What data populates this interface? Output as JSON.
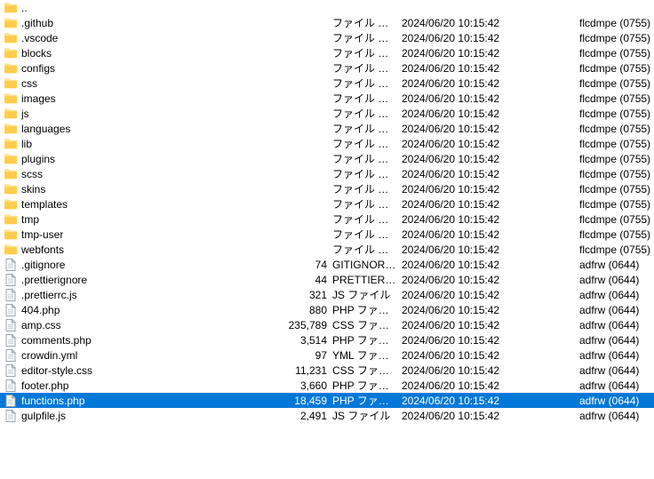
{
  "rows": [
    {
      "name": "..",
      "size": "",
      "type": "",
      "date": "",
      "perm": "",
      "icon": "folder",
      "selected": false
    },
    {
      "name": ".github",
      "size": "",
      "type": "ファイル フォ…",
      "date": "2024/06/20 10:15:42",
      "perm": "flcdmpe (0755)",
      "icon": "folder",
      "selected": false
    },
    {
      "name": ".vscode",
      "size": "",
      "type": "ファイル フォ…",
      "date": "2024/06/20 10:15:42",
      "perm": "flcdmpe (0755)",
      "icon": "folder",
      "selected": false
    },
    {
      "name": "blocks",
      "size": "",
      "type": "ファイル フォ…",
      "date": "2024/06/20 10:15:42",
      "perm": "flcdmpe (0755)",
      "icon": "folder",
      "selected": false
    },
    {
      "name": "configs",
      "size": "",
      "type": "ファイル フォ…",
      "date": "2024/06/20 10:15:42",
      "perm": "flcdmpe (0755)",
      "icon": "folder",
      "selected": false
    },
    {
      "name": "css",
      "size": "",
      "type": "ファイル フォ…",
      "date": "2024/06/20 10:15:42",
      "perm": "flcdmpe (0755)",
      "icon": "folder",
      "selected": false
    },
    {
      "name": "images",
      "size": "",
      "type": "ファイル フォ…",
      "date": "2024/06/20 10:15:42",
      "perm": "flcdmpe (0755)",
      "icon": "folder",
      "selected": false
    },
    {
      "name": "js",
      "size": "",
      "type": "ファイル フォ…",
      "date": "2024/06/20 10:15:42",
      "perm": "flcdmpe (0755)",
      "icon": "folder",
      "selected": false
    },
    {
      "name": "languages",
      "size": "",
      "type": "ファイル フォ…",
      "date": "2024/06/20 10:15:42",
      "perm": "flcdmpe (0755)",
      "icon": "folder",
      "selected": false
    },
    {
      "name": "lib",
      "size": "",
      "type": "ファイル フォ…",
      "date": "2024/06/20 10:15:42",
      "perm": "flcdmpe (0755)",
      "icon": "folder",
      "selected": false
    },
    {
      "name": "plugins",
      "size": "",
      "type": "ファイル フォ…",
      "date": "2024/06/20 10:15:42",
      "perm": "flcdmpe (0755)",
      "icon": "folder",
      "selected": false
    },
    {
      "name": "scss",
      "size": "",
      "type": "ファイル フォ…",
      "date": "2024/06/20 10:15:42",
      "perm": "flcdmpe (0755)",
      "icon": "folder",
      "selected": false
    },
    {
      "name": "skins",
      "size": "",
      "type": "ファイル フォ…",
      "date": "2024/06/20 10:15:42",
      "perm": "flcdmpe (0755)",
      "icon": "folder",
      "selected": false
    },
    {
      "name": "templates",
      "size": "",
      "type": "ファイル フォ…",
      "date": "2024/06/20 10:15:42",
      "perm": "flcdmpe (0755)",
      "icon": "folder",
      "selected": false
    },
    {
      "name": "tmp",
      "size": "",
      "type": "ファイル フォ…",
      "date": "2024/06/20 10:15:42",
      "perm": "flcdmpe (0755)",
      "icon": "folder",
      "selected": false
    },
    {
      "name": "tmp-user",
      "size": "",
      "type": "ファイル フォ…",
      "date": "2024/06/20 10:15:42",
      "perm": "flcdmpe (0755)",
      "icon": "folder",
      "selected": false
    },
    {
      "name": "webfonts",
      "size": "",
      "type": "ファイル フォ…",
      "date": "2024/06/20 10:15:42",
      "perm": "flcdmpe (0755)",
      "icon": "folder",
      "selected": false
    },
    {
      "name": ".gitignore",
      "size": "74",
      "type": "GITIGNORE…",
      "date": "2024/06/20 10:15:42",
      "perm": "adfrw (0644)",
      "icon": "file",
      "selected": false
    },
    {
      "name": ".prettierignore",
      "size": "44",
      "type": "PRETTIERIG…",
      "date": "2024/06/20 10:15:42",
      "perm": "adfrw (0644)",
      "icon": "file",
      "selected": false
    },
    {
      "name": ".prettierrc.js",
      "size": "321",
      "type": "JS ファイル",
      "date": "2024/06/20 10:15:42",
      "perm": "adfrw (0644)",
      "icon": "file",
      "selected": false
    },
    {
      "name": "404.php",
      "size": "880",
      "type": "PHP ファイル",
      "date": "2024/06/20 10:15:42",
      "perm": "adfrw (0644)",
      "icon": "file",
      "selected": false
    },
    {
      "name": "amp.css",
      "size": "235,789",
      "type": "CSS ファイル",
      "date": "2024/06/20 10:15:42",
      "perm": "adfrw (0644)",
      "icon": "file",
      "selected": false
    },
    {
      "name": "comments.php",
      "size": "3,514",
      "type": "PHP ファイル",
      "date": "2024/06/20 10:15:42",
      "perm": "adfrw (0644)",
      "icon": "file",
      "selected": false
    },
    {
      "name": "crowdin.yml",
      "size": "97",
      "type": "YML ファイル",
      "date": "2024/06/20 10:15:42",
      "perm": "adfrw (0644)",
      "icon": "file",
      "selected": false
    },
    {
      "name": "editor-style.css",
      "size": "11,231",
      "type": "CSS ファイル",
      "date": "2024/06/20 10:15:42",
      "perm": "adfrw (0644)",
      "icon": "file",
      "selected": false
    },
    {
      "name": "footer.php",
      "size": "3,660",
      "type": "PHP ファイル",
      "date": "2024/06/20 10:15:42",
      "perm": "adfrw (0644)",
      "icon": "file",
      "selected": false
    },
    {
      "name": "functions.php",
      "size": "18,459",
      "type": "PHP ファイル",
      "date": "2024/06/20 10:15:42",
      "perm": "adfrw (0644)",
      "icon": "file",
      "selected": true
    },
    {
      "name": "gulpfile.js",
      "size": "2,491",
      "type": "JS ファイル",
      "date": "2024/06/20 10:15:42",
      "perm": "adfrw (0644)",
      "icon": "file",
      "selected": false
    }
  ]
}
